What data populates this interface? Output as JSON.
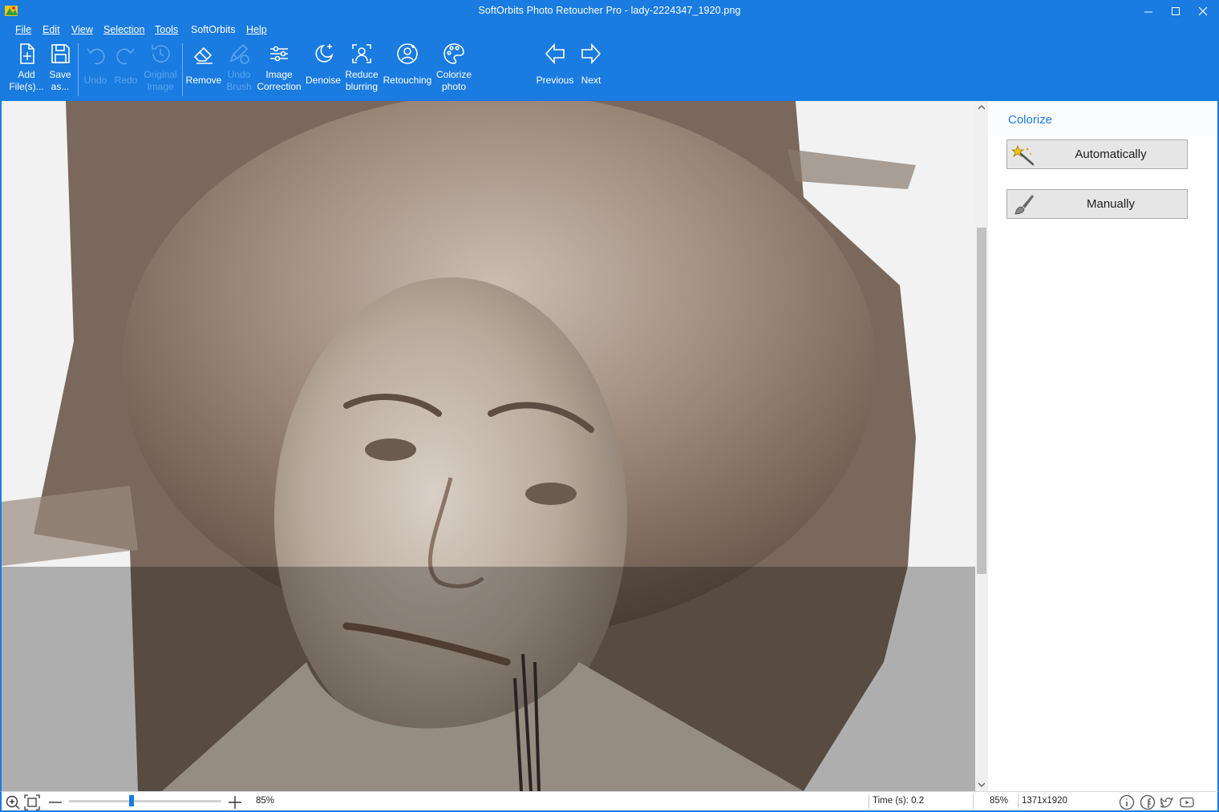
{
  "window": {
    "title": "SoftOrbits Photo Retoucher Pro - lady-2224347_1920.png",
    "accent_color": "#1a7be0"
  },
  "menu": [
    {
      "label": "File"
    },
    {
      "label": "Edit"
    },
    {
      "label": "View"
    },
    {
      "label": "Selection"
    },
    {
      "label": "Tools"
    },
    {
      "label": "SoftOrbits"
    },
    {
      "label": "Help"
    }
  ],
  "toolbar": {
    "add_files": {
      "label": "Add\nFile(s)...",
      "icon": "add-file-icon",
      "enabled": true
    },
    "save_as": {
      "label": "Save\nas...",
      "icon": "save-icon",
      "enabled": true
    },
    "undo": {
      "label": "Undo",
      "icon": "undo-icon",
      "enabled": false
    },
    "redo": {
      "label": "Redo",
      "icon": "redo-icon",
      "enabled": false
    },
    "original_image": {
      "label": "Original\nImage",
      "icon": "history-icon",
      "enabled": false
    },
    "remove": {
      "label": "Remove",
      "icon": "eraser-icon",
      "enabled": true
    },
    "undo_brush": {
      "label": "Undo\nBrush",
      "icon": "undo-brush-icon",
      "enabled": false
    },
    "image_correction": {
      "label": "Image\nCorrection",
      "icon": "sliders-icon",
      "enabled": true
    },
    "denoise": {
      "label": "Denoise",
      "icon": "moon-sparkle-icon",
      "enabled": true
    },
    "reduce_blurring": {
      "label": "Reduce\nblurring",
      "icon": "focus-person-icon",
      "enabled": true
    },
    "retouching": {
      "label": "Retouching",
      "icon": "retouch-face-icon",
      "enabled": true
    },
    "colorize_photo": {
      "label": "Colorize\nphoto",
      "icon": "palette-icon",
      "enabled": true
    },
    "previous": {
      "label": "Previous",
      "icon": "arrow-left-icon",
      "enabled": true
    },
    "next": {
      "label": "Next",
      "icon": "arrow-right-icon",
      "enabled": true
    }
  },
  "panel": {
    "title": "Colorize",
    "automatically_label": "Automatically",
    "manually_label": "Manually"
  },
  "statusbar": {
    "zoom_value": "85%",
    "zoom_slider_fraction": 0.41,
    "time": "Time (s): 0.2",
    "zoom_right": "85%",
    "dimensions": "1371x1920"
  }
}
